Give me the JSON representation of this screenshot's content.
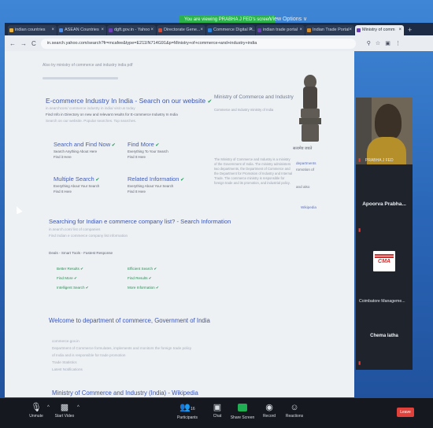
{
  "share_banner": "You are viewing PRABHA J FED's screen",
  "view_options": "View Options ∨",
  "tabs": [
    {
      "label": "indian countries",
      "color": "#e9b13b",
      "active": false
    },
    {
      "label": "ASEAN Countries",
      "color": "#4c8be6",
      "active": false
    },
    {
      "label": "dgft.gov.in - Yahoo",
      "color": "#6c3fb5",
      "active": false
    },
    {
      "label": "Directorate Gene...",
      "color": "#d04a3a",
      "active": false
    },
    {
      "label": "Commerce Digital P...",
      "color": "#2a7fd8",
      "active": false
    },
    {
      "label": "indian trade portal",
      "color": "#6c3fb5",
      "active": false
    },
    {
      "label": "Indian Trade Portal",
      "color": "#d38b2a",
      "active": false
    },
    {
      "label": "Ministry of comm",
      "color": "#6c3fb5",
      "active": true
    }
  ],
  "address": {
    "back": "←",
    "forward": "→",
    "reload": "C",
    "url": "in.search.yahoo.com/search?fr=mcafee&type=E211IN714G91&p=Ministry+of+commerce+and+industry+india",
    "icons": [
      "search-icon",
      "star-icon",
      "extension-icon",
      "menu-icon"
    ]
  },
  "page": {
    "crumb_top": "Also try ministry of commerce and industry india pdf",
    "ad1": {
      "title": "E-commerce Industry In India - Search on our website",
      "desc1": "in.searchcom/ commerce industry in india/ visit us today",
      "desc2": "Find Info in Directory on new and relevant results for E-commerce Industry In India",
      "desc3": "Search on our website. Popular searches. Top searches."
    },
    "links_left": [
      {
        "title": "Search and Find Now",
        "sub1": "Search Anything About Here",
        "sub2": "Find it Here"
      },
      {
        "title": "Multiple Search",
        "sub1": "Everything About Your Search",
        "sub2": "Find It Here"
      }
    ],
    "links_right": [
      {
        "title": "Find More",
        "sub1": "Everything To Your Search",
        "sub2": "Find It Here"
      },
      {
        "title": "Related Information",
        "sub1": "Everything About Your Search",
        "sub2": "Find It Here"
      }
    ],
    "ad2": {
      "title": "Searching for Indian e commerce company list? - Search Information",
      "desc1": "in.search.com/ list of companies",
      "desc2": "Find Indian e commerce company list information"
    },
    "ad2_note": "Deals - Smart Tools - Fastest Response",
    "ad2_links": [
      {
        "label": "Better Results",
        "col": 0
      },
      {
        "label": "Efficient Search",
        "col": 1
      },
      {
        "label": "Find More",
        "col": 0
      },
      {
        "label": "Find Results",
        "col": 1
      },
      {
        "label": "Intelligent Search",
        "col": 0
      },
      {
        "label": "More Information",
        "col": 1
      }
    ],
    "result3": {
      "title": "Welcome to department of commerce, Government of India",
      "lines": [
        "commerce.gov.in",
        "Department of Commerce formulates, implements and monitors the foreign trade policy",
        "of India and is responsible for trade promotion",
        "Trade Statistics",
        "Latest Notifications"
      ]
    },
    "result4": {
      "title": "Ministry of Commerce and Industry (India) - Wikipedia"
    },
    "side": {
      "title": "Ministry of Commerce and Industry",
      "subtitle": "Commerce and Industry ministry of India",
      "emblem_label": "सत्यमेव जयते",
      "text": "The Ministry of Commerce and Industry is a ministry of the Government of India. The ministry administers two departments, the Department of Commerce and the Department for Promotion of Industry and Internal Trade. The commerce ministry is responsible for foreign trade and its promotion, and industrial policy.",
      "more": "Wikipedia",
      "highlight1": "departments",
      "highlight2": "romotion of",
      "highlight3": "and also"
    }
  },
  "participants": [
    {
      "label": "PRABHA J FED",
      "muted": true
    },
    {
      "name": "Apoorva Prabha...",
      "muted": true
    },
    {
      "name": "Coimbatore Manageme...",
      "muted": false
    },
    {
      "name": "Chema latha",
      "muted": true
    }
  ],
  "cma_logo_text": "CMA",
  "toolbar": {
    "unmute": "Unmute",
    "start_video": "Start Video",
    "participants": "Participants",
    "participants_count": "16",
    "chat": "Chat",
    "share_screen": "Share Screen",
    "record": "Record",
    "reactions": "Reactions",
    "leave": "Leave"
  }
}
